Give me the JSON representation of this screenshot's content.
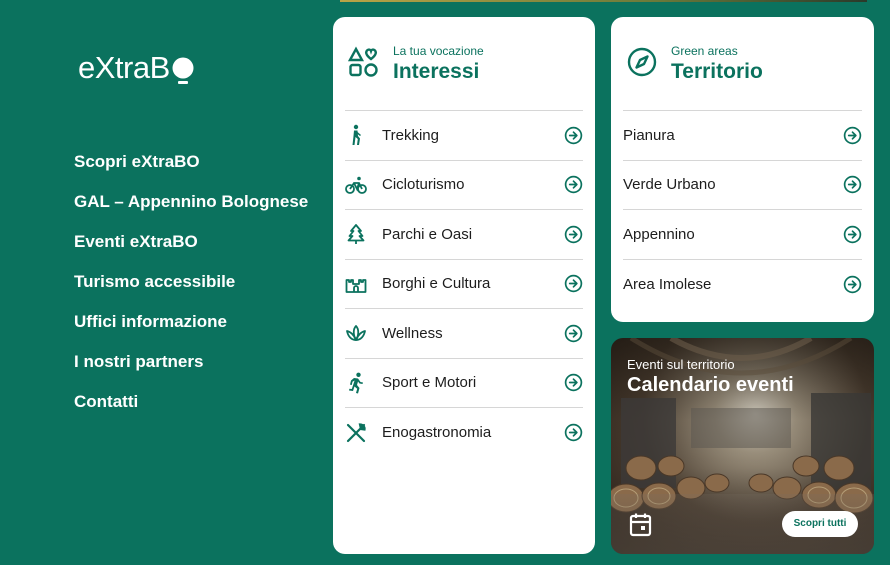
{
  "brand": {
    "logo_text": "eXtraB",
    "accent": "#0b725e"
  },
  "nav": {
    "items": [
      "Scopri eXtraBO",
      "GAL – Appennino Bolognese",
      "Eventi eXtraBO",
      "Turismo accessibile",
      "Uffici informazione",
      "I nostri partners",
      "Contatti"
    ]
  },
  "interessi": {
    "subtitle": "La tua vocazione",
    "title": "Interessi",
    "icon": "shapes-heart-icon",
    "items": [
      {
        "label": "Trekking",
        "icon": "hiker-icon"
      },
      {
        "label": "Cicloturismo",
        "icon": "bicycle-icon"
      },
      {
        "label": "Parchi e Oasi",
        "icon": "tree-icon"
      },
      {
        "label": "Borghi e Cultura",
        "icon": "castle-icon"
      },
      {
        "label": "Wellness",
        "icon": "lotus-icon"
      },
      {
        "label": "Sport e Motori",
        "icon": "runner-icon"
      },
      {
        "label": "Enogastronomia",
        "icon": "cutlery-icon"
      }
    ]
  },
  "territorio": {
    "subtitle": "Green areas",
    "title": "Territorio",
    "icon": "compass-icon",
    "items": [
      {
        "label": "Pianura"
      },
      {
        "label": "Verde Urbano"
      },
      {
        "label": "Appennino"
      },
      {
        "label": "Area Imolese"
      }
    ]
  },
  "eventi": {
    "subtitle": "Eventi sul territorio",
    "title": "Calendario eventi",
    "button_label": "Scopri tutti",
    "icon": "calendar-icon"
  }
}
